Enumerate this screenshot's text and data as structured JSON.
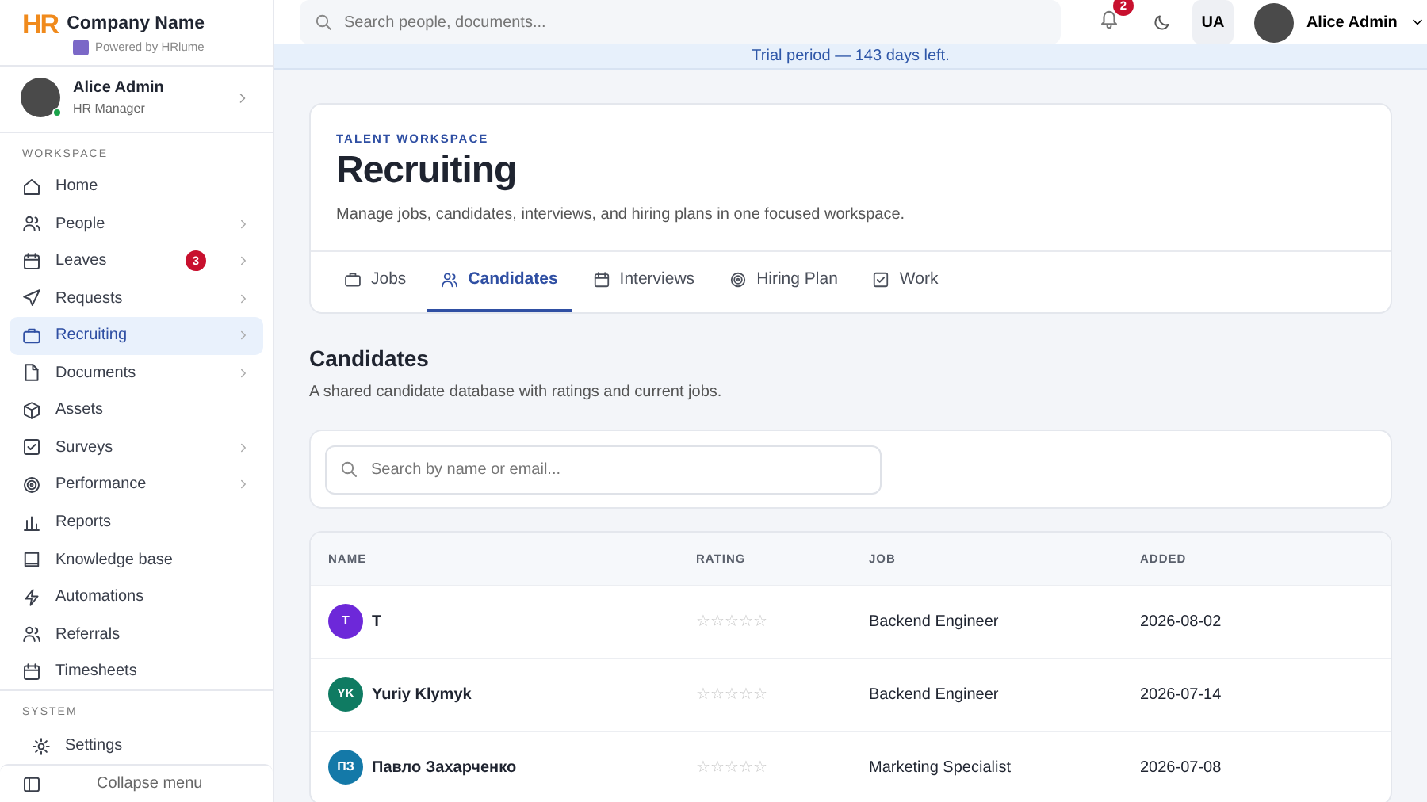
{
  "brand": {
    "logo": "HR",
    "company": "Company Name",
    "powered_by": "Powered by HRlume"
  },
  "user_card": {
    "name": "Alice Admin",
    "role": "HR Manager",
    "online": true
  },
  "sidebar": {
    "sections": [
      {
        "label": "WORKSPACE",
        "items": [
          {
            "label": "Home",
            "submenu": false,
            "selected": false
          },
          {
            "label": "People",
            "submenu": true,
            "selected": false
          },
          {
            "label": "Leaves",
            "submenu": true,
            "selected": false,
            "badge": "3"
          },
          {
            "label": "Requests",
            "submenu": true,
            "selected": false
          },
          {
            "label": "Recruiting",
            "submenu": true,
            "selected": true
          },
          {
            "label": "Documents",
            "submenu": true,
            "selected": false
          },
          {
            "label": "Assets",
            "submenu": false,
            "selected": false
          },
          {
            "label": "Surveys",
            "submenu": true,
            "selected": false
          },
          {
            "label": "Performance",
            "submenu": true,
            "selected": false
          },
          {
            "label": "Reports",
            "submenu": false,
            "selected": false
          },
          {
            "label": "Knowledge base",
            "submenu": false,
            "selected": false
          },
          {
            "label": "Automations",
            "submenu": false,
            "selected": false
          },
          {
            "label": "Referrals",
            "submenu": false,
            "selected": false
          },
          {
            "label": "Timesheets",
            "submenu": false,
            "selected": false
          }
        ]
      },
      {
        "label": "SYSTEM",
        "items": [
          {
            "label": "Settings",
            "submenu": false,
            "selected": false
          }
        ]
      }
    ],
    "collapse": "Collapse menu"
  },
  "topbar": {
    "search": {
      "placeholder": "Search people, documents..."
    },
    "notifications": "2",
    "language": "UA",
    "user": "Alice Admin"
  },
  "banner": "Trial period — 143 days left.",
  "header": {
    "eyebrow": "TALENT WORKSPACE",
    "title": "Recruiting",
    "subtitle": "Manage jobs, candidates, interviews, and hiring plans in one focused workspace."
  },
  "tabs": [
    {
      "label": "Jobs",
      "selected": false
    },
    {
      "label": "Candidates",
      "selected": true
    },
    {
      "label": "Interviews",
      "selected": false
    },
    {
      "label": "Hiring Plan",
      "selected": false
    },
    {
      "label": "Work",
      "selected": false
    }
  ],
  "section": {
    "title": "Candidates",
    "subtitle": "A shared candidate database with ratings and current jobs."
  },
  "candidate_search": {
    "placeholder": "Search by name or email..."
  },
  "table": {
    "columns": [
      "NAME",
      "RATING",
      "JOB",
      "ADDED"
    ],
    "rows": [
      {
        "initials": "T",
        "color": "#6d28d9",
        "name": "T",
        "stars": 0,
        "job": "Backend Engineer",
        "added": "2026-08-02"
      },
      {
        "initials": "YK",
        "color": "#0f7b62",
        "name": "Yuriy Klymyk",
        "stars": 0,
        "job": "Backend Engineer",
        "added": "2026-07-14"
      },
      {
        "initials": "ПЗ",
        "color": "#1479a8",
        "name": "Павло Захарченко",
        "stars": 0,
        "job": "Marketing Specialist",
        "added": "2026-07-08"
      }
    ]
  }
}
